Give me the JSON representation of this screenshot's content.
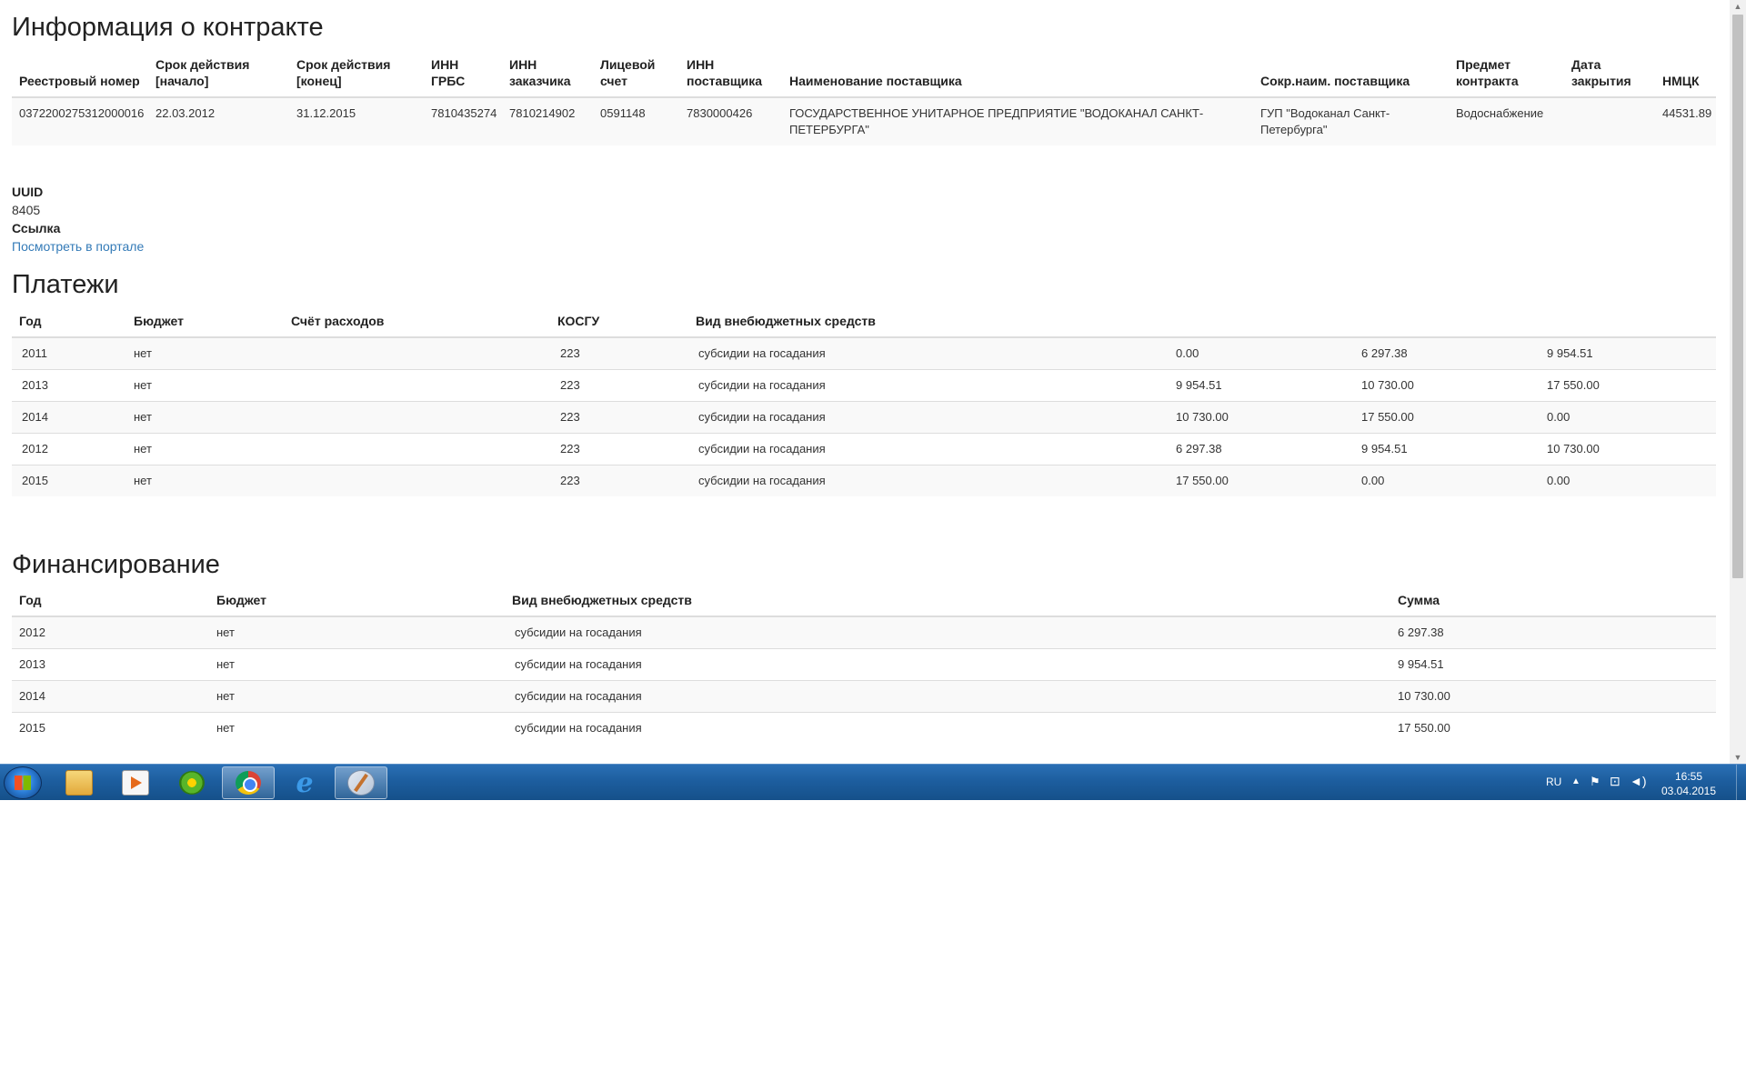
{
  "contract": {
    "title": "Информация о контракте",
    "headers": [
      "Реестровый номер",
      "Срок действия [начало]",
      "Срок действия [конец]",
      "ИНН ГРБС",
      "ИНН заказчика",
      "Лицевой счет",
      "ИНН поставщика",
      "Наименование поставщика",
      "Сокр.наим. поставщика",
      "Предмет контракта",
      "Дата закрытия",
      "НМЦК"
    ],
    "row": [
      "0372200275312000016",
      "22.03.2012",
      "31.12.2015",
      "7810435274",
      "7810214902",
      "0591148",
      "7830000426",
      "ГОСУДАРСТВЕННОЕ УНИТАРНОЕ ПРЕДПРИЯТИЕ \"ВОДОКАНАЛ САНКТ-ПЕТЕРБУРГА\"",
      "ГУП \"Водоканал Санкт-Петербурга\"",
      "Водоснабжение",
      "",
      "44531.89"
    ]
  },
  "meta": {
    "uuid_label": "UUID",
    "uuid_value": "8405",
    "link_label": "Ссылка",
    "link_text": "Посмотреть в портале"
  },
  "payments": {
    "title": "Платежи",
    "headers": [
      "Год",
      "Бюджет",
      "Счёт расходов",
      "КОСГУ",
      "Вид внебюджетных средств",
      "",
      "",
      ""
    ],
    "rows": [
      [
        "2011",
        "нет",
        "",
        "223",
        "субсидии на госадания",
        "0.00",
        "6 297.38",
        "9 954.51"
      ],
      [
        "2013",
        "нет",
        "",
        "223",
        "субсидии на госадания",
        "9 954.51",
        "10 730.00",
        "17 550.00"
      ],
      [
        "2014",
        "нет",
        "",
        "223",
        "субсидии на госадания",
        "10 730.00",
        "17 550.00",
        "0.00"
      ],
      [
        "2012",
        "нет",
        "",
        "223",
        "субсидии на госадания",
        "6 297.38",
        "9 954.51",
        "10 730.00"
      ],
      [
        "2015",
        "нет",
        "",
        "223",
        "субсидии на госадания",
        "17 550.00",
        "0.00",
        "0.00"
      ]
    ]
  },
  "financing": {
    "title": "Финансирование",
    "headers": [
      "Год",
      "Бюджет",
      "Вид внебюджетных средств",
      "Сумма"
    ],
    "rows": [
      [
        "2012",
        "нет",
        "субсидии на госадания",
        "6 297.38"
      ],
      [
        "2013",
        "нет",
        "субсидии на госадания",
        "9 954.51"
      ],
      [
        "2014",
        "нет",
        "субсидии на госадания",
        "10 730.00"
      ],
      [
        "2015",
        "нет",
        "субсидии на госадания",
        "17 550.00"
      ]
    ]
  },
  "taskbar": {
    "lang": "RU",
    "time": "16:55",
    "date": "03.04.2015",
    "icons": [
      "windows-start-icon",
      "explorer-folder-icon",
      "media-player-icon",
      "icq-icon",
      "chrome-icon",
      "internet-explorer-icon",
      "paint-icon"
    ]
  },
  "colors": {
    "link": "#337ab7",
    "stripe": "#f9f9f9",
    "taskbar": "#1d5e9f"
  }
}
